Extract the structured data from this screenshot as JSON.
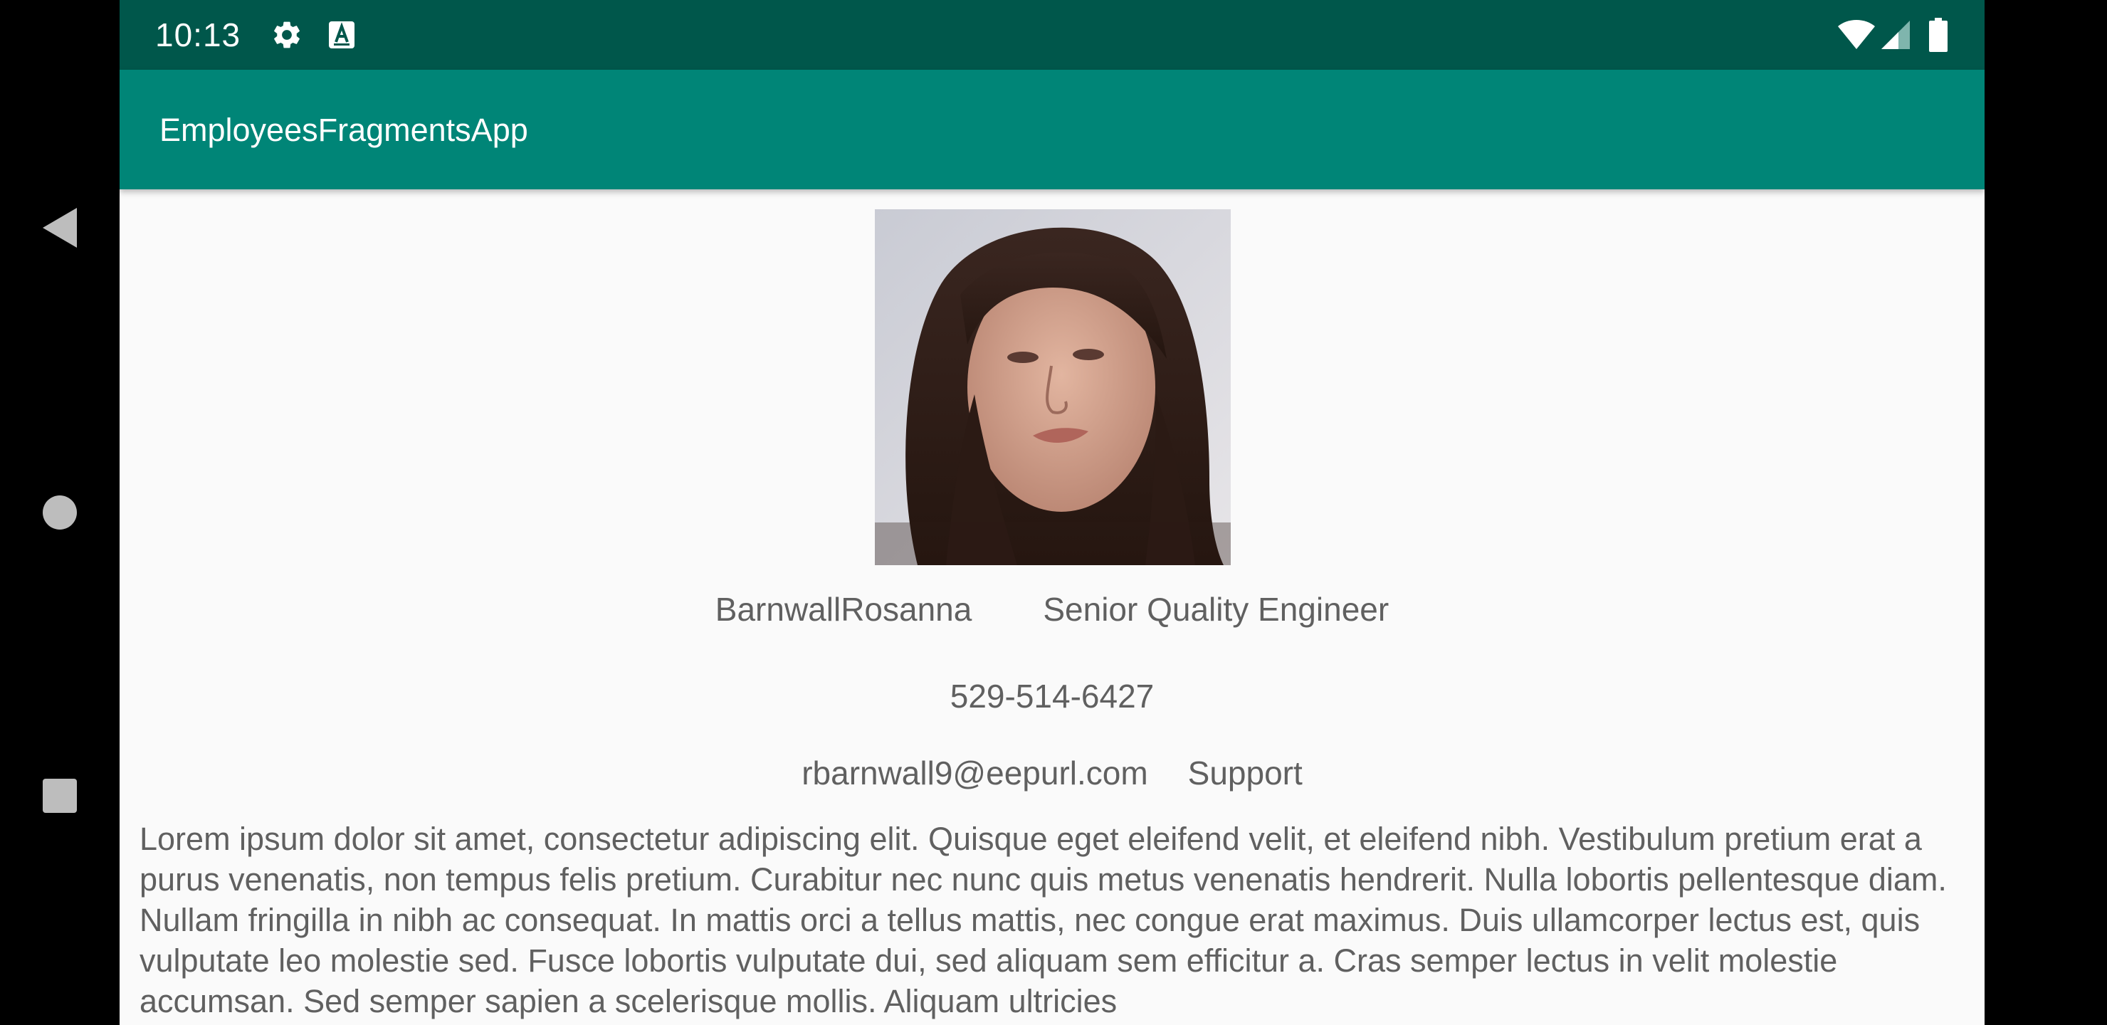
{
  "status_bar": {
    "time": "10:13",
    "icons": [
      "gear-icon",
      "text-a-icon",
      "wifi-icon",
      "signal-icon",
      "battery-icon"
    ]
  },
  "navigation": {
    "buttons": [
      "back-icon",
      "home-icon",
      "recents-icon"
    ]
  },
  "app_bar": {
    "title": "EmployeesFragmentsApp"
  },
  "employee": {
    "name": "BarnwallRosanna",
    "title": "Senior Quality Engineer",
    "phone": "529-514-6427",
    "email": "rbarnwall9@eepurl.com",
    "department": "Support",
    "bio": "Lorem ipsum dolor sit amet, consectetur adipiscing elit. Quisque eget eleifend velit, et eleifend nibh. Vestibulum pretium erat a purus venenatis, non tempus felis pretium. Curabitur nec nunc quis metus venenatis hendrerit. Nulla lobortis pellentesque diam. Nullam fringilla in nibh ac consequat. In mattis orci a tellus mattis, nec congue erat maximus. Duis ullamcorper lectus est, quis vulputate leo molestie sed. Fusce lobortis vulputate dui, sed aliquam sem efficitur a. Cras semper lectus in velit molestie accumsan. Sed semper sapien a scelerisque mollis. Aliquam ultricies"
  },
  "colors": {
    "status_bar": "#00574b",
    "app_bar": "#008577",
    "background": "#fafafa",
    "text": "#606060"
  }
}
